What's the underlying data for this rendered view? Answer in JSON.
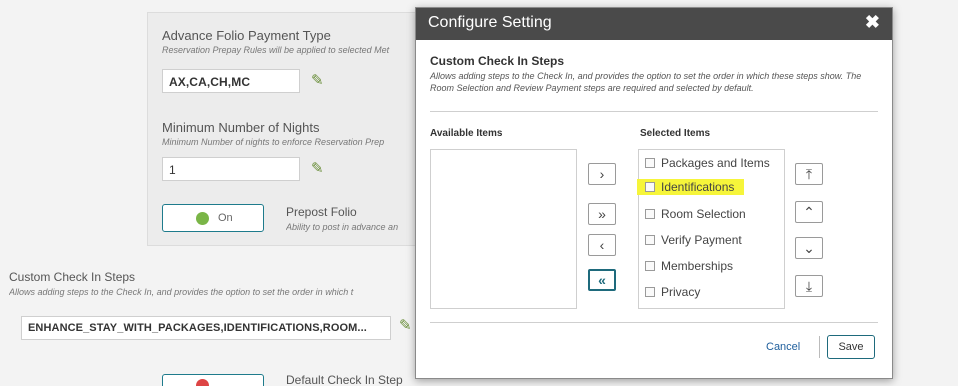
{
  "background": {
    "advance_folio": {
      "label": "Advance Folio Payment Type",
      "desc": "Reservation Prepay Rules will be applied to selected Met",
      "value": "AX,CA,CH,MC"
    },
    "min_nights": {
      "label": "Minimum Number of Nights",
      "desc": "Minimum Number of nights to enforce Reservation Prep",
      "value": "1"
    },
    "prepost_folio": {
      "toggle_label": "On",
      "label": "Prepost Folio",
      "desc": "Ability to post in advance an"
    },
    "custom_steps": {
      "label": "Custom Check In Steps",
      "desc": "Allows adding steps to the Check In, and provides the option to set the order in which t",
      "value": "ENHANCE_STAY_WITH_PACKAGES,IDENTIFICATIONS,ROOM..."
    },
    "default_step": {
      "label": "Default Check In Step"
    }
  },
  "modal": {
    "title": "Configure Setting",
    "section_title": "Custom Check In Steps",
    "section_desc": "Allows adding steps to the Check In, and provides the option to set the order in which these steps show. The Room Selection and Review Payment steps are required and selected by default.",
    "available_header": "Available Items",
    "selected_header": "Selected Items",
    "selected_items": [
      "Packages and Items",
      "Identifications",
      "Room Selection",
      "Verify Payment",
      "Memberships",
      "Privacy"
    ],
    "move_buttons": {
      "add_one": "›",
      "add_all": "»",
      "remove_one": "‹",
      "remove_all": "«"
    },
    "order_buttons": {
      "top": "⤒",
      "up": "⌃",
      "down": "⌄",
      "bottom": "⤓"
    },
    "cancel": "Cancel",
    "save": "Save"
  },
  "colors": {
    "header_bg": "#4a4a4a",
    "accent": "#1e6a7c",
    "highlight": "#f6f53a",
    "toggle_on": "#7ab547",
    "pencil": "#6a8e3a"
  }
}
